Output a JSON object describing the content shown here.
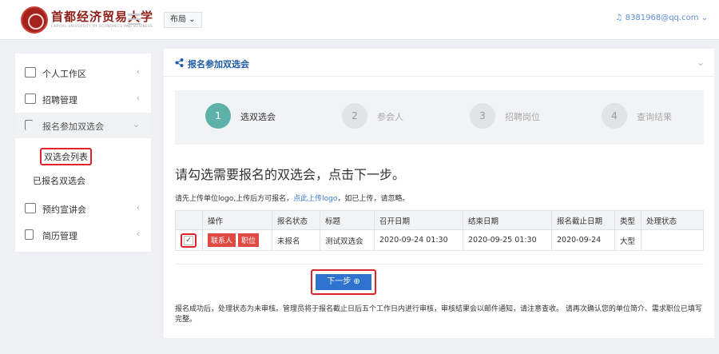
{
  "header": {
    "brand": "首都经济贸易大学",
    "brand_sub": "CAPITAL UNIVERSITY OF ECONOMICS AND BUSINESS",
    "layout_btn": "布局 ⌄",
    "user": "♫ 8381968@qq.com ⌄"
  },
  "sidebar": {
    "items": [
      {
        "label": "个人工作区",
        "chev": "‹"
      },
      {
        "label": "招聘管理",
        "chev": "‹"
      },
      {
        "label": "报名参加双选会",
        "chev": "⌄"
      },
      {
        "label": "预约宣讲会",
        "chev": "‹"
      },
      {
        "label": "简历管理",
        "chev": "‹"
      }
    ],
    "sub_items": [
      {
        "label": "双选会列表"
      },
      {
        "label": "已报名双选会"
      }
    ]
  },
  "panel": {
    "title": "报名参加双选会",
    "chev": "⌄"
  },
  "steps": [
    {
      "num": "1",
      "label": "选双选会"
    },
    {
      "num": "2",
      "label": "参会人"
    },
    {
      "num": "3",
      "label": "招聘岗位"
    },
    {
      "num": "4",
      "label": "查询结果"
    }
  ],
  "prompt": "请勾选需要报名的双选会，点击下一步。",
  "note": {
    "before": "请先上传单位logo,上传后方可报名，",
    "link": "点此上传logo",
    "after": "，如已上传，请忽略。"
  },
  "table": {
    "headers": [
      "",
      "操作",
      "报名状态",
      "标题",
      "召开日期",
      "结束日期",
      "报名截止日期",
      "类型",
      "处理状态"
    ],
    "row": {
      "checkbox": "✓",
      "action_1": "联系人",
      "action_2": "职位",
      "status": "未报名",
      "title": "测试双选会",
      "start": "2020-09-24 01:30",
      "end": "2020-09-25 01:30",
      "deadline": "2020-09-24",
      "type": "大型",
      "process": ""
    }
  },
  "next_button": "下一步 ⊕",
  "footnote": "报名成功后，处理状态为未审核。管理员将于报名截止日后五个工作日内进行审核，审核结果会以邮件通知，请注意查收。 请再次确认您的单位简介、需求职位已填写完整。",
  "colors": {
    "accent": "#2f73cf",
    "highlight": "#e0232a",
    "step_done": "#5db1a8",
    "action_red": "#e04a42",
    "brand": "#8f1e18"
  }
}
